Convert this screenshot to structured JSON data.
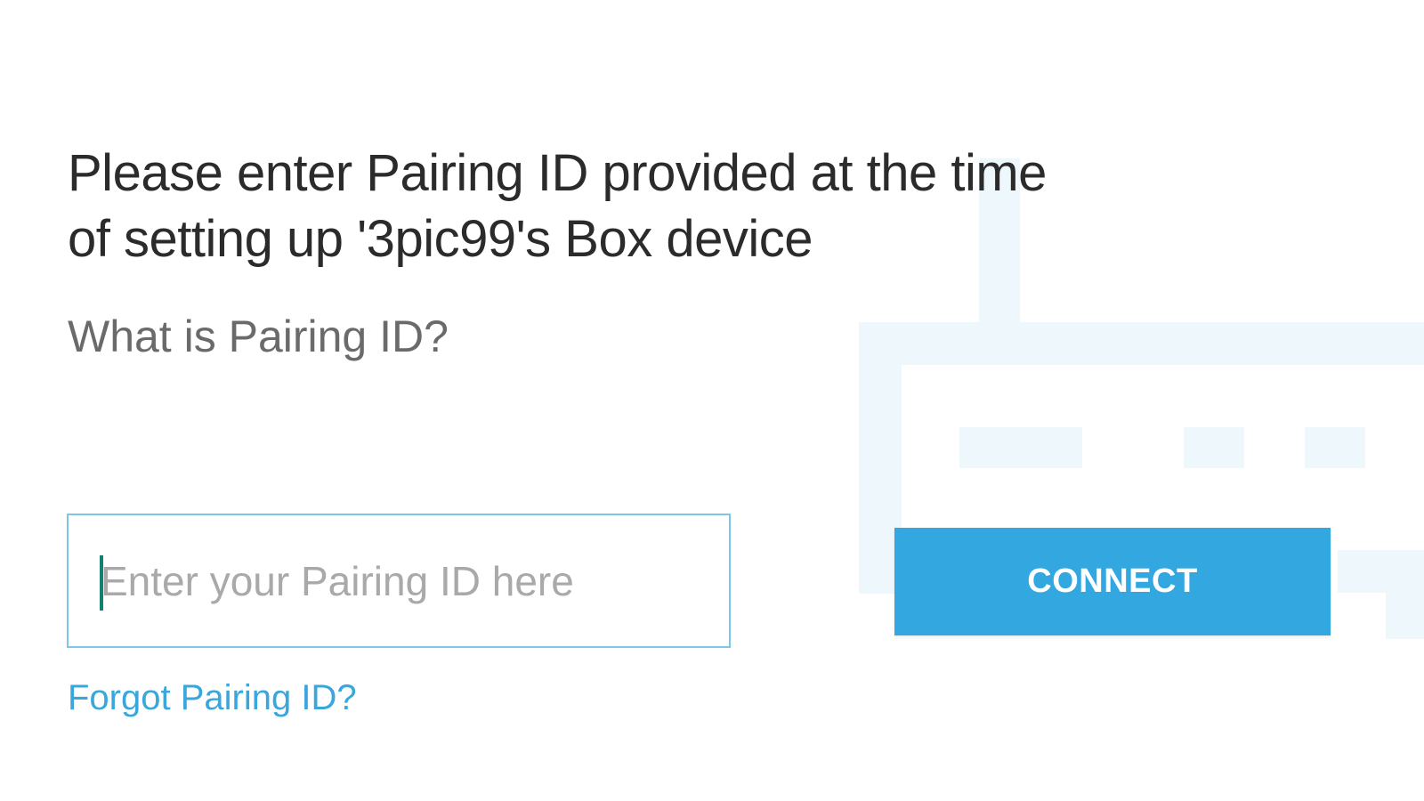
{
  "instruction": {
    "line1": "Please enter Pairing ID provided at the time",
    "line2": "of setting up '3pic99's Box device"
  },
  "help": {
    "what_is_label": "What is Pairing ID?"
  },
  "pairing_input": {
    "value": "",
    "placeholder": "Enter your Pairing ID here"
  },
  "connect_button": {
    "label": "CONNECT"
  },
  "forgot_link": {
    "label": "Forgot Pairing ID?"
  },
  "colors": {
    "accent": "#33a8e0",
    "link": "#3aa7dc",
    "input_border": "#7cc6e6",
    "caret": "#14806f",
    "illustration": "#eef7fc"
  },
  "icons": {
    "background": "router-icon"
  }
}
